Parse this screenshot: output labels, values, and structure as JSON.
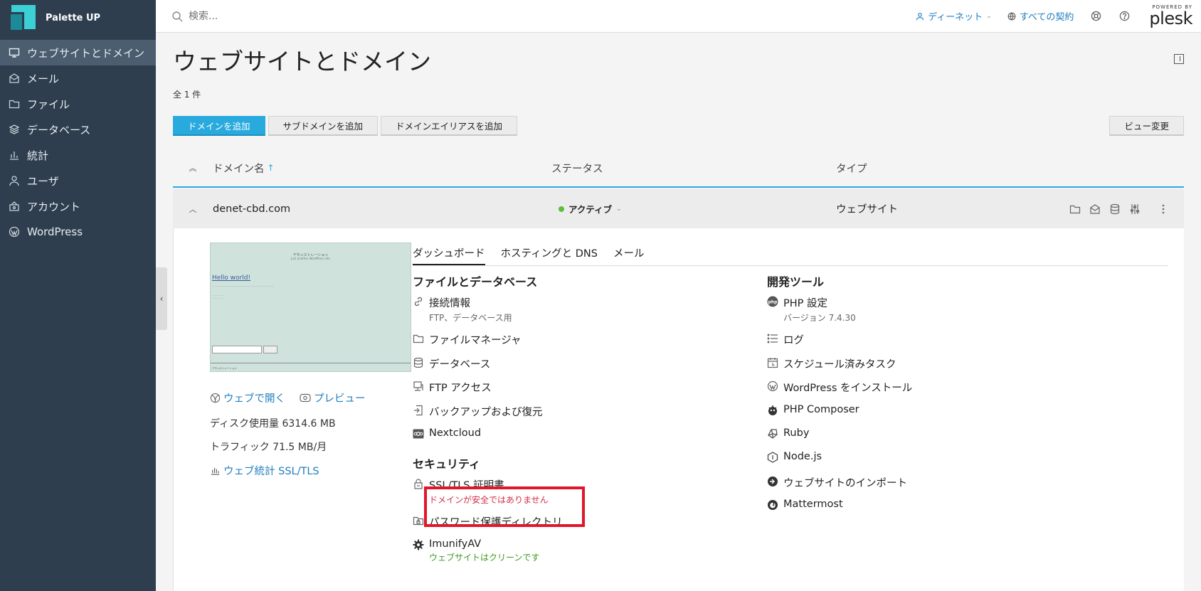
{
  "app": {
    "brand": "Palette UP"
  },
  "sidebar": {
    "items": [
      {
        "label": "ウェブサイトとドメイン",
        "icon": "monitor-icon",
        "active": true
      },
      {
        "label": "メール",
        "icon": "mail-icon"
      },
      {
        "label": "ファイル",
        "icon": "folder-icon"
      },
      {
        "label": "データベース",
        "icon": "layers-icon"
      },
      {
        "label": "統計",
        "icon": "bar-chart-icon"
      },
      {
        "label": "ユーザ",
        "icon": "user-icon"
      },
      {
        "label": "アカウント",
        "icon": "account-icon"
      },
      {
        "label": "WordPress",
        "icon": "wordpress-icon"
      }
    ]
  },
  "header": {
    "search_placeholder": "検索...",
    "user": "ディーネット",
    "subscriptions": "すべての契約",
    "powered_by": "POWERED BY",
    "plesk": "plesk"
  },
  "page": {
    "title": "ウェブサイトとドメイン",
    "count": "全 1 件"
  },
  "toolbar": {
    "add_domain": "ドメインを追加",
    "add_subdomain": "サブドメインを追加",
    "add_alias": "ドメインエイリアスを追加",
    "change_view": "ビュー変更"
  },
  "table": {
    "col_domain": "ドメイン名",
    "col_status": "ステータス",
    "col_type": "タイプ"
  },
  "domain": {
    "name": "denet-cbd.com",
    "status": "アクティブ",
    "type": "ウェブサイト",
    "status_color": "#5bbf3a"
  },
  "preview": {
    "site_title": "デモンストレーション",
    "site_sub": "Just another WordPress site",
    "hello": "Hello world!",
    "footer": "デモンストレーション"
  },
  "site_info": {
    "open_web": "ウェブで開く",
    "preview": "プレビュー",
    "disk": "ディスク使用量 6314.6 MB",
    "traffic": "トラフィック 71.5 MB/月",
    "stats": "ウェブ統計 SSL/TLS"
  },
  "tabs": [
    "ダッシュボード",
    "ホスティングと DNS",
    "メール"
  ],
  "sections": {
    "files_db": {
      "title": "ファイルとデータベース",
      "connection": "接続情報",
      "connection_sub": "FTP、データベース用",
      "file_manager": "ファイルマネージャ",
      "database": "データベース",
      "ftp": "FTP アクセス",
      "backup": "バックアップおよび復元",
      "nextcloud": "Nextcloud"
    },
    "security": {
      "title": "セキュリティ",
      "ssl": "SSL/TLS 証明書",
      "ssl_warning": "ドメインが安全ではありません",
      "password_dir": "パスワード保護ディレクトリ",
      "imunify": "ImunifyAV",
      "imunify_status": "ウェブサイトはクリーンです"
    },
    "dev_tools": {
      "title": "開発ツール",
      "php": "PHP 設定",
      "php_version": "バージョン 7.4.30",
      "logs": "ログ",
      "scheduled": "スケジュール済みタスク",
      "wp_install": "WordPress をインストール",
      "composer": "PHP Composer",
      "ruby": "Ruby",
      "node": "Node.js",
      "import": "ウェブサイトのインポート",
      "mattermost": "Mattermost"
    }
  },
  "colors": {
    "accent": "#28aade",
    "sidebar": "#2e3e4e",
    "warning": "#d32f4a",
    "ok": "#3d9a1f",
    "highlight": "#e0162b"
  }
}
